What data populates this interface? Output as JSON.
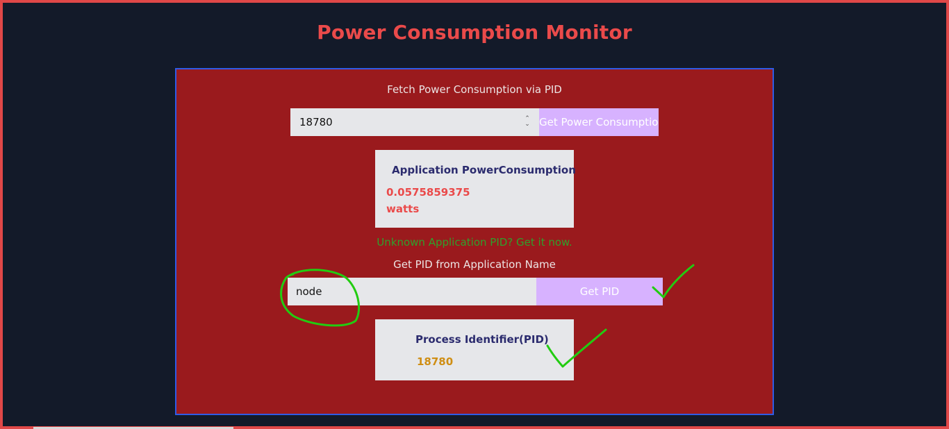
{
  "app": {
    "title": "Power Consumption Monitor"
  },
  "pid_section": {
    "label": "Fetch Power Consumption via PID",
    "pid_value": "18780",
    "button_label": "Get Power Consumption"
  },
  "power_card": {
    "title": "Application PowerConsumption",
    "value": "0.0575859375",
    "unit": "watts"
  },
  "unknown_link": "Unknown Application PID? Get it now.",
  "name_section": {
    "label": "Get PID from Application Name",
    "app_name_value": "node",
    "button_label": "Get PID"
  },
  "pid_card": {
    "title": "Process Identifier(PID)",
    "value": "18780"
  },
  "colors": {
    "background": "#131a29",
    "frame": "#e04848",
    "panel": "#9a1a1d",
    "panel_border": "#2f5ce6",
    "button": "#d7b2ff",
    "annotation": "#22cc11"
  }
}
